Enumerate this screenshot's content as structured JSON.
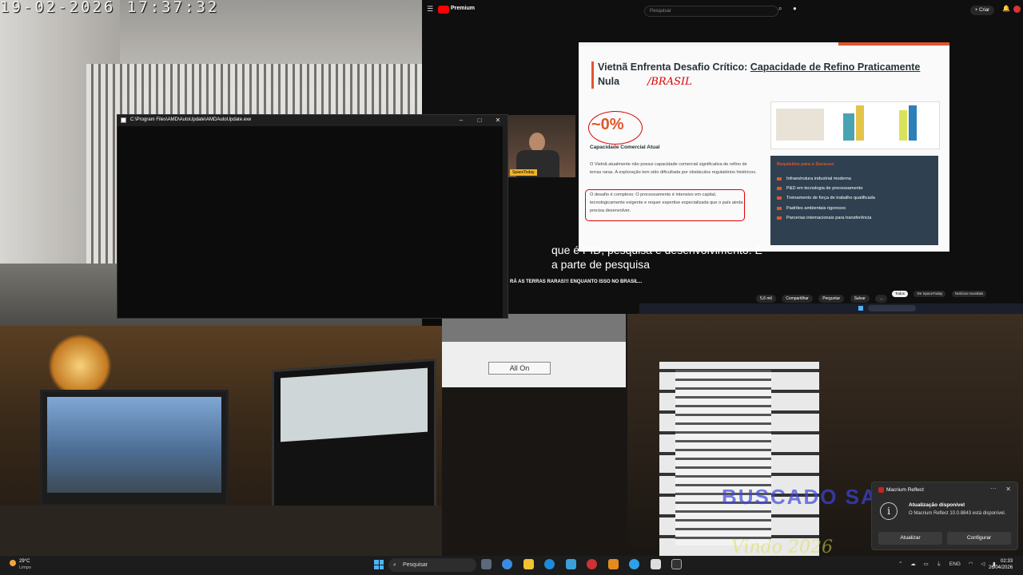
{
  "camera_osd": {
    "datetime": "19-02-2026  17:37:32"
  },
  "console_window": {
    "title": "C:\\Program Files\\AMD\\AutoUpdate\\AMDAutoUpdate.exe",
    "min": "–",
    "max": "□",
    "close": "✕"
  },
  "youtube": {
    "premium_label": "Premium",
    "search_placeholder": "Pesquisar",
    "create_label": "+ Criar",
    "slide": {
      "title_part1": "Vietnã Enfrenta Desafio Crítico:",
      "title_part2": "Capacidade de Refino Praticamente",
      "title_part3": "Nula",
      "annotation": "/BRASIL",
      "percent": "~0%",
      "caption": "Capacidade Comercial Atual",
      "body1": "O Vietnã atualmente não possui capacidade comercial significativa de refino de terras raras. A exploração tem sido dificultada por obstáculos regulatórios históricos.",
      "body2": "O desafio é complexo: O processamento é intensivo em capital, tecnologicamente exigente e requer expertise especializada que o país ainda precisa desenvolver.",
      "panel_head": "Requisitos para o Sucesso",
      "panel_items": [
        "Infraestrutura industrial moderna",
        "P&D em tecnologia de processamento",
        "Treinamento de força de trabalho qualificada",
        "Padrões ambientais rigorosos",
        "Parcerias internacionais para transferência"
      ]
    },
    "webcam_tag": "SpaceToday",
    "subtitle_line1": "que é PID, pesquisa e desenvolvimento. É",
    "subtitle_line2": "a parte de pesquisa",
    "video_title": "RÁ AS TERRAS RARAS!!! ENQUANTO ISSO NO BRASIL...",
    "actions": [
      "5,6 mil",
      "Compartilhar",
      "Perguntar",
      "Salvar",
      "…"
    ],
    "chips": [
      "Todos",
      "De SpaceToday",
      "Notícias mundiais"
    ]
  },
  "capture_panel": {
    "all_on_label": "All On"
  },
  "camera_watermark": {
    "line1": "BUSCADO SAL",
    "line2": "Vindo 2026"
  },
  "notification": {
    "app": "Macrium Reflect",
    "title": "Atualização disponível",
    "body": "O Macrium Reflect 10.0.8843 está disponível.",
    "btn_update": "Atualizar",
    "btn_config": "Configurar",
    "more": "···",
    "close": "✕"
  },
  "taskbar": {
    "weather_temp": "29°C",
    "weather_cond": "Limpo",
    "search_label": "Pesquisar",
    "lang": "ENG",
    "time": "02:33",
    "date": "26/04/2026"
  },
  "colors": {
    "accent": "#e0552e",
    "youtube_red": "#ff0000",
    "windows_blue": "#4fb3f6"
  }
}
